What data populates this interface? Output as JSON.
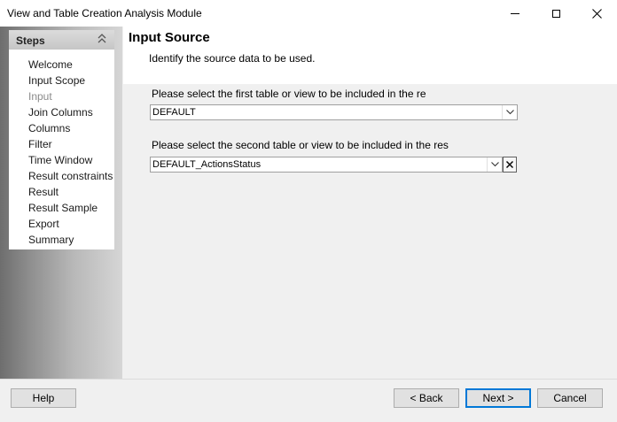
{
  "window": {
    "title": "View and Table Creation Analysis Module"
  },
  "steps": {
    "header": "Steps",
    "items": [
      {
        "label": "Welcome",
        "current": false
      },
      {
        "label": "Input Scope",
        "current": false
      },
      {
        "label": "Input",
        "current": true
      },
      {
        "label": "Join Columns",
        "current": false
      },
      {
        "label": "Columns",
        "current": false
      },
      {
        "label": "Filter",
        "current": false
      },
      {
        "label": "Time Window",
        "current": false
      },
      {
        "label": "Result constraints",
        "current": false
      },
      {
        "label": "Result",
        "current": false
      },
      {
        "label": "Result Sample",
        "current": false
      },
      {
        "label": "Export",
        "current": false
      },
      {
        "label": "Summary",
        "current": false
      }
    ]
  },
  "page": {
    "title": "Input Source",
    "subtitle": "Identify the source data to be used."
  },
  "form": {
    "first_label": "Please select the first table or view to be included in the re",
    "first_value": "DEFAULT",
    "second_label": "Please select the second table or view to be included in the res",
    "second_value": "DEFAULT_ActionsStatus"
  },
  "buttons": {
    "help": "Help",
    "back": "< Back",
    "next": "Next >",
    "cancel": "Cancel"
  },
  "colors": {
    "default_button_border": "#0078d7",
    "current_step": "#8a8a8a"
  }
}
